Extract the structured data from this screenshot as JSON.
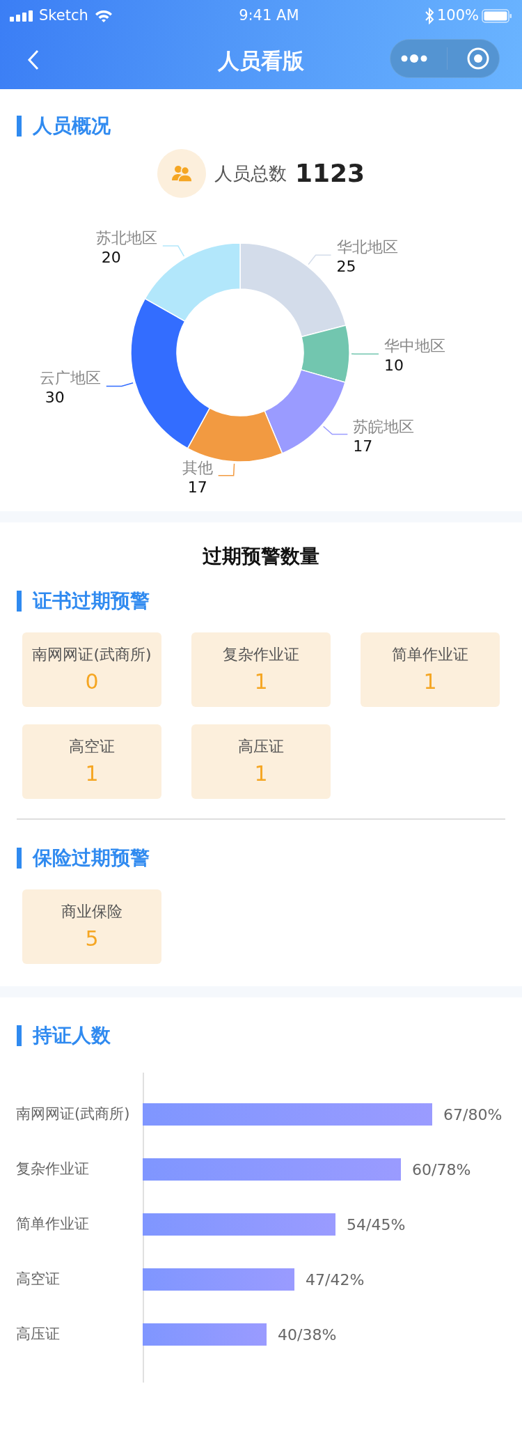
{
  "status_bar": {
    "carrier": "Sketch",
    "time": "9:41 AM",
    "battery": "100%"
  },
  "header": {
    "title": "人员看版"
  },
  "overview": {
    "title": "人员概况",
    "total_label": "人员总数",
    "total": "1123",
    "chart_data": {
      "type": "donut",
      "categories": [
        "华北地区",
        "华中地区",
        "苏皖地区",
        "其他",
        "云广地区",
        "苏北地区"
      ],
      "values": [
        25,
        10,
        17,
        17,
        30,
        20
      ],
      "colors": [
        "#d3dcea",
        "#72c6af",
        "#9a9bff",
        "#f29a41",
        "#336dff",
        "#b2e7fb"
      ],
      "data_labels": true
    }
  },
  "warnings": {
    "title": "过期预警数量",
    "groups": [
      {
        "title": "证书过期预警",
        "items": [
          {
            "label": "南网网证(武商所)",
            "count": "0"
          },
          {
            "label": "复杂作业证",
            "count": "1"
          },
          {
            "label": "简单作业证",
            "count": "1"
          },
          {
            "label": "高空证",
            "count": "1"
          },
          {
            "label": "高压证",
            "count": "1"
          }
        ]
      },
      {
        "title": "保险过期预警",
        "items": [
          {
            "label": "商业保险",
            "count": "5"
          }
        ]
      }
    ]
  },
  "holders": {
    "title": "持证人数",
    "rows": [
      {
        "label": "南网网证(武商所)",
        "reading": "67/80%"
      },
      {
        "label": "复杂作业证",
        "reading": "60/78%"
      },
      {
        "label": "简单作业证",
        "reading": "54/45%"
      },
      {
        "label": "高空证",
        "reading": "47/42%"
      },
      {
        "label": "高压证",
        "reading": "40/38%"
      }
    ]
  }
}
